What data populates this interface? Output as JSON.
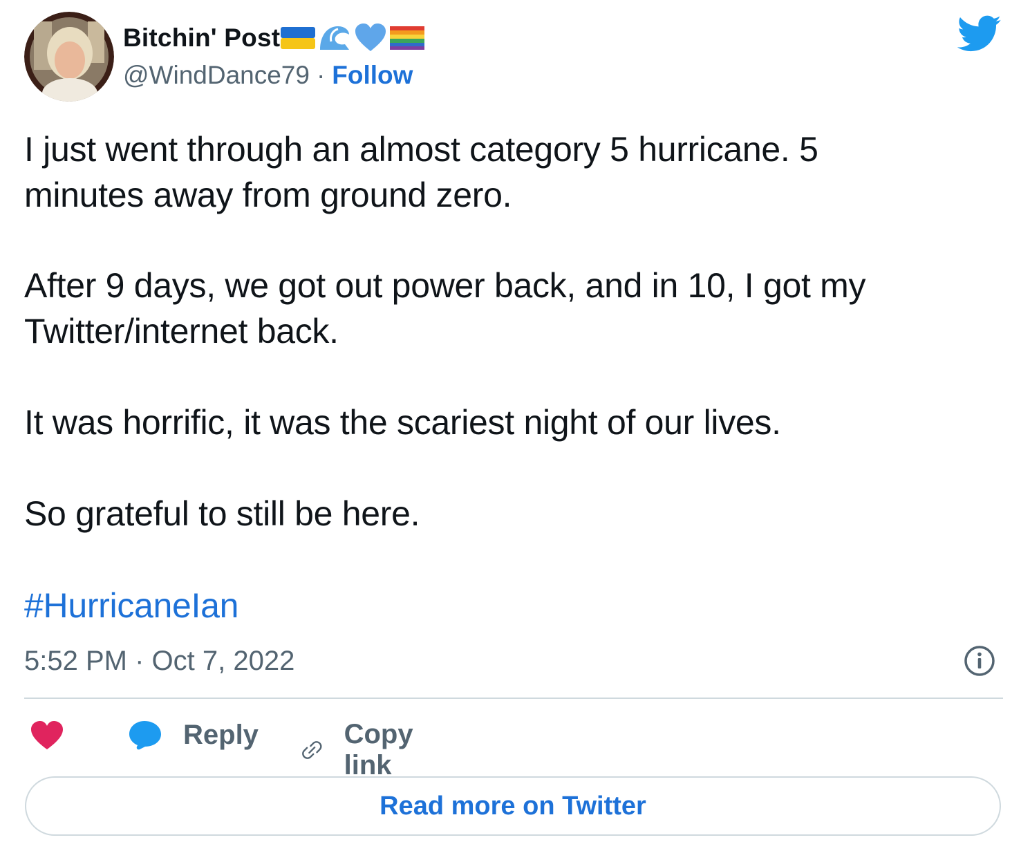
{
  "author": {
    "display_name": "Bitchin' Post",
    "emojis": [
      "ukraine-flag-icon",
      "wave-icon",
      "blue-heart-icon",
      "rainbow-flag-icon"
    ],
    "handle": "@WindDance79",
    "separator": "·",
    "follow_label": "Follow"
  },
  "tweet": {
    "paragraphs": [
      "I just went through an almost category 5 hurricane. 5\nminutes away from ground zero.",
      "After 9 days, we got out power back, and in 10, I got my\nTwitter/internet back.",
      "It was horrific, it was the scariest night of our lives.",
      "So grateful to still be here."
    ],
    "hashtag": "#HurricaneIan",
    "time": "5:52 PM",
    "separator": "·",
    "date": "Oct 7, 2022"
  },
  "actions": {
    "reply_label": "Reply",
    "copy_link_label": "Copy link",
    "read_more_label": "Read more on Twitter"
  },
  "colors": {
    "text": "#0f1419",
    "secondary": "#536471",
    "link": "#1d71d8",
    "twitter_blue": "#1d9bf0",
    "like_pink": "#f91880",
    "divider": "#cfd9de"
  }
}
